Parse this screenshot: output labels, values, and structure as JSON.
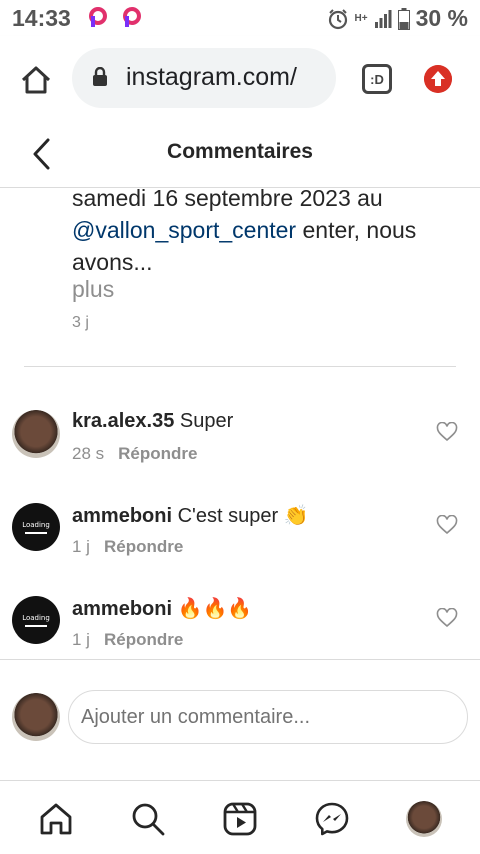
{
  "status_bar": {
    "time": "14:33",
    "battery": "30 %",
    "network": "H+",
    "icons": [
      "p-notification-icon",
      "p-notification-icon",
      "alarm-icon",
      "signal-icon",
      "battery-icon"
    ]
  },
  "browser": {
    "url": "instagram.com/",
    "tab_label": ":D",
    "icons": [
      "home-icon",
      "lock-icon",
      "tab-switcher-icon",
      "upgrade-arrow-icon"
    ]
  },
  "header": {
    "title": "Commentaires",
    "back_icon": "chevron-left-icon"
  },
  "caption": {
    "line_before_mention": "samedi 16 septembre 2023 au",
    "mention": "@vallon_sport_center",
    "text_after_mention": " enter, nous avons...",
    "more_label": "plus",
    "time": "3 j"
  },
  "comments": [
    {
      "user": "kra.alex.35",
      "text": " Super",
      "time": "28 s",
      "reply_label": "Répondre",
      "avatar": "photo"
    },
    {
      "user": "ammeboni",
      "text": " C'est super 👏",
      "time": "1 j",
      "reply_label": "Répondre",
      "avatar": "loading"
    },
    {
      "user": "ammeboni",
      "text": " 🔥🔥🔥",
      "time": "1 j",
      "reply_label": "Répondre",
      "avatar": "loading"
    }
  ],
  "avatar_loading_text": "Loading",
  "composer": {
    "placeholder": "Ajouter un commentaire..."
  },
  "bottom_nav": [
    "home-icon",
    "search-icon",
    "reels-icon",
    "messenger-icon",
    "profile-avatar"
  ],
  "colors": {
    "text": "#262626",
    "secondary_text": "#8e8e8e",
    "mention": "#00376b",
    "divider": "#dbdbdb",
    "upgrade_red": "#d93025"
  }
}
